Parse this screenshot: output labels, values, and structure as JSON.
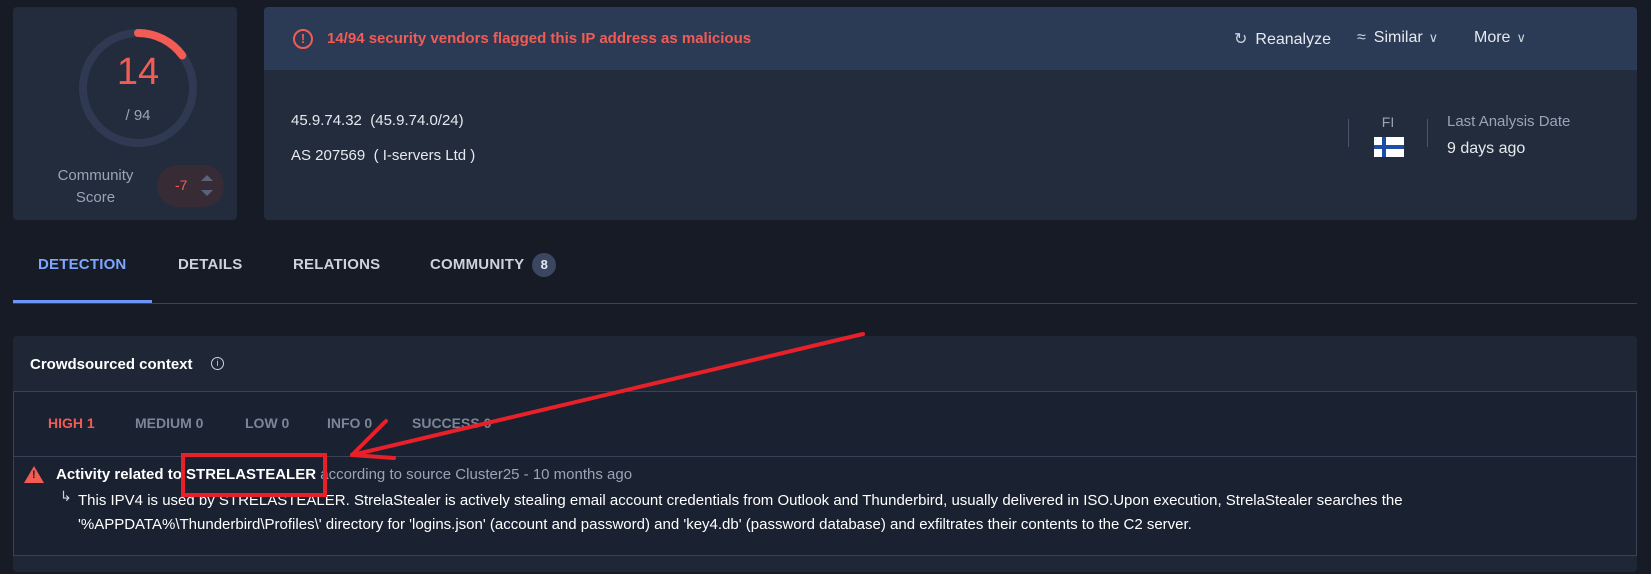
{
  "score": {
    "detections": "14",
    "total": "/ 94",
    "detection_fraction": 0.149,
    "community_label": "Community Score",
    "community_value": "-7"
  },
  "alert": {
    "text": "14/94 security vendors flagged this IP address as malicious"
  },
  "header_actions": {
    "reanalyze": "Reanalyze",
    "similar": "Similar",
    "more": "More"
  },
  "ip_info": {
    "ip": "45.9.74.32",
    "range": "(45.9.74.0/24)",
    "as_number": "AS 207569",
    "as_owner": "( I-servers Ltd )",
    "country_code": "FI",
    "last_analysis_label": "Last Analysis Date",
    "last_analysis_value": "9 days ago"
  },
  "tabs": [
    {
      "label": "DETECTION"
    },
    {
      "label": "DETAILS"
    },
    {
      "label": "RELATIONS"
    },
    {
      "label": "COMMUNITY"
    }
  ],
  "community_count": "8",
  "crowdsourced": {
    "title": "Crowdsourced context",
    "severities": [
      {
        "label": "HIGH 1"
      },
      {
        "label": "MEDIUM 0"
      },
      {
        "label": "LOW 0"
      },
      {
        "label": "INFO 0"
      },
      {
        "label": "SUCCESS 0"
      }
    ],
    "entry": {
      "prefix": "Activity related to",
      "name": "STRELASTEALER",
      "source": "according to source Cluster25 - 10 months ago",
      "line1": "This IPV4 is used by STRELASTEALER. StrelaStealer is actively stealing email account credentials from Outlook and Thunderbird, usually delivered in ISO.Upon execution, StrelaStealer searches the",
      "line2": "'%APPDATA%\\Thunderbird\\Profiles\\' directory for 'logins.json' (account and password) and 'key4.db' (password database) and exfiltrates their contents to the C2 server."
    }
  },
  "colors": {
    "malicious": "#f25c54",
    "accent": "#7ea6ff",
    "annotation": "#e8202a"
  }
}
